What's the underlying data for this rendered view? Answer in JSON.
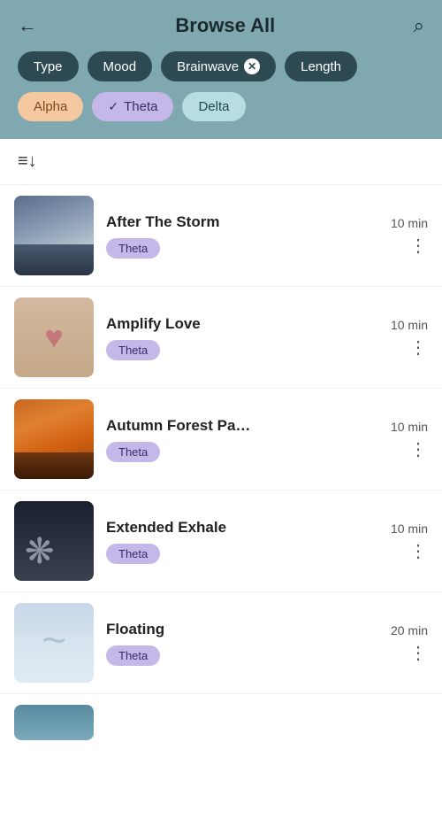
{
  "header": {
    "title": "Browse All",
    "back_label": "←",
    "search_label": "⌕"
  },
  "filters": {
    "row1": [
      {
        "id": "type",
        "label": "Type",
        "active": false
      },
      {
        "id": "mood",
        "label": "Mood",
        "active": false
      },
      {
        "id": "brainwave",
        "label": "Brainwave",
        "active": true,
        "hasClose": true
      },
      {
        "id": "length",
        "label": "Length",
        "active": false
      }
    ],
    "brainwave_options": [
      {
        "id": "alpha",
        "label": "Alpha",
        "selected": false,
        "style": "alpha"
      },
      {
        "id": "theta",
        "label": "Theta",
        "selected": true,
        "style": "theta"
      },
      {
        "id": "delta",
        "label": "Delta",
        "selected": false,
        "style": "delta"
      }
    ]
  },
  "sort_icon": "≡↓",
  "items": [
    {
      "id": 1,
      "title": "After The Storm",
      "tag": "Theta",
      "duration": "10 min",
      "thumb": "storm"
    },
    {
      "id": 2,
      "title": "Amplify Love",
      "tag": "Theta",
      "duration": "10 min",
      "thumb": "love"
    },
    {
      "id": 3,
      "title": "Autumn Forest Pa…",
      "tag": "Theta",
      "duration": "10 min",
      "thumb": "autumn"
    },
    {
      "id": 4,
      "title": "Extended Exhale",
      "tag": "Theta",
      "duration": "10 min",
      "thumb": "exhale"
    },
    {
      "id": 5,
      "title": "Floating",
      "tag": "Theta",
      "duration": "20 min",
      "thumb": "floating"
    }
  ],
  "more_icon": "⋮"
}
